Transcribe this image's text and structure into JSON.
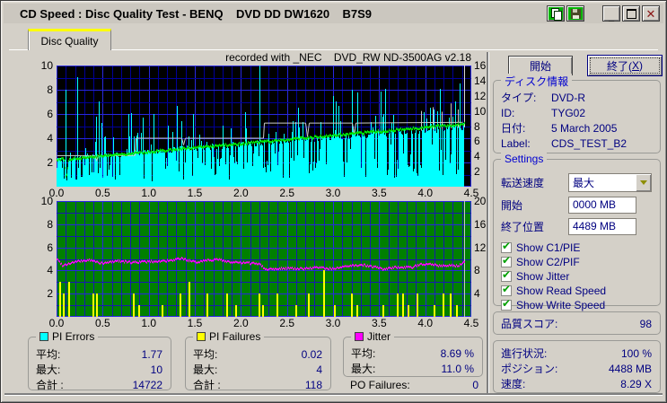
{
  "window": {
    "title": "CD Speed : Disc Quality Test - BENQ    DVD DD DW1620    B7S9",
    "glyphs": {
      "minimize": "_",
      "close": "✕"
    },
    "titlebar_icon_names": [
      "copy-icon",
      "save-icon",
      "minimize-icon",
      "maximize-icon",
      "close-icon"
    ]
  },
  "tabs": [
    {
      "label": "Disc Quality",
      "selected": true
    }
  ],
  "recorded_with": "recorded with _NEC    DVD_RW ND-3500AG v2.18",
  "buttons": {
    "start": "開始",
    "exit_pre": "終了(",
    "exit_key": "X",
    "exit_post": ")"
  },
  "disc_info": {
    "caption": "ディスク情報",
    "fields": [
      {
        "label": "タイプ:",
        "value": "DVD-R"
      },
      {
        "label": "ID:",
        "value": "TYG02"
      },
      {
        "label": "日付:",
        "value": "5 March 2005"
      },
      {
        "label": "Label:",
        "value": "CDS_TEST_B2"
      }
    ]
  },
  "settings": {
    "caption": "Settings",
    "transfer_rate": {
      "label": "転送速度",
      "value": "最大"
    },
    "start": {
      "label": "開始",
      "value": "0000 MB"
    },
    "end": {
      "label": "終了位置",
      "value": "4489 MB"
    },
    "checkboxes": [
      {
        "label": "Show C1/PIE",
        "checked": true
      },
      {
        "label": "Show C2/PIF",
        "checked": true
      },
      {
        "label": "Show Jitter",
        "checked": true
      },
      {
        "label": "Show Read Speed",
        "checked": true
      },
      {
        "label": "Show Write Speed",
        "checked": true
      }
    ],
    "check_glyph": "✔"
  },
  "quality_score": {
    "label": "品質スコア:",
    "value": "98"
  },
  "progress": {
    "fields": [
      {
        "label": "進行状況:",
        "value": "100 %"
      },
      {
        "label": "ポジション:",
        "value": "4488 MB"
      },
      {
        "label": "速度:",
        "value": "8.29 X"
      }
    ]
  },
  "stats": {
    "pi_errors": {
      "caption": "PI Errors",
      "swatch": "#00FFFF",
      "rows": [
        {
          "label": "平均:",
          "value": "1.77"
        },
        {
          "label": "最大:",
          "value": "10"
        },
        {
          "label": "合計 :",
          "value": "14722"
        }
      ]
    },
    "pi_failures": {
      "caption": "PI Failures",
      "swatch": "#FFFF00",
      "rows": [
        {
          "label": "平均:",
          "value": "0.02"
        },
        {
          "label": "最大:",
          "value": "4"
        },
        {
          "label": "合計 :",
          "value": "118"
        }
      ]
    },
    "jitter": {
      "caption": "Jitter",
      "swatch": "#FF00FF",
      "rows": [
        {
          "label": "平均:",
          "value": "8.69 %"
        },
        {
          "label": "最大:",
          "value": "11.0 %"
        }
      ]
    },
    "po_failures": {
      "label": "PO Failures:",
      "value": "0"
    }
  },
  "chart_data": [
    {
      "type": "area",
      "name": "PI Errors with Read/Write Speed overlay",
      "bg": "#000000",
      "grid_minor": "#000098",
      "grid_major": "#2828e0",
      "xlim": [
        0,
        4.5
      ],
      "x_unit": "GB",
      "data_end_gb": 4.42,
      "x_ticks": [
        "0.0",
        "0.5",
        "1.0",
        "1.5",
        "2.0",
        "2.5",
        "3.0",
        "3.5",
        "4.0",
        "4.5"
      ],
      "left_axis": {
        "range": [
          0,
          10
        ],
        "ticks": [
          "10",
          "8",
          "6",
          "4",
          "2"
        ],
        "series": "PI Errors"
      },
      "right_axis": {
        "range": [
          0,
          16
        ],
        "ticks": [
          "16",
          "14",
          "12",
          "10",
          "8",
          "6",
          "4",
          "2"
        ],
        "series": "Speed (X)"
      },
      "series": [
        {
          "name": "PI Errors",
          "color": "#00ffff",
          "style": "spikes",
          "axis": "left",
          "average": 1.77,
          "maximum": 10,
          "total": 14722,
          "seed": 1337,
          "envelope": [
            [
              0,
              2.3
            ],
            [
              4.42,
              4.9
            ]
          ],
          "tall_spikes": [
            [
              0.1,
              8
            ],
            [
              0.22,
              9
            ],
            [
              0.46,
              7
            ],
            [
              0.78,
              6
            ],
            [
              1.05,
              6
            ],
            [
              1.48,
              6
            ],
            [
              2.2,
              10
            ],
            [
              2.62,
              6.5
            ],
            [
              3.2,
              8
            ],
            [
              3.55,
              6
            ],
            [
              4.05,
              6.5
            ],
            [
              4.32,
              7
            ]
          ]
        },
        {
          "name": "Write Speed",
          "color": "#cccccc",
          "style": "step-line",
          "axis": "right",
          "points": [
            [
              0,
              4.1
            ],
            [
              0.42,
              4.1
            ],
            [
              0.43,
              3.4
            ],
            [
              0.45,
              4.1
            ],
            [
              0.85,
              4.1
            ],
            [
              0.86,
              6.4
            ],
            [
              1.35,
              6.4
            ],
            [
              1.37,
              5.5
            ],
            [
              1.39,
              6.4
            ],
            [
              2.24,
              6.4
            ],
            [
              2.25,
              8.4
            ],
            [
              2.7,
              8.4
            ],
            [
              2.72,
              6.6
            ],
            [
              2.74,
              8.4
            ],
            [
              3.2,
              8.4
            ],
            [
              3.22,
              6.9
            ],
            [
              3.24,
              8.4
            ],
            [
              4.4,
              8.5
            ]
          ],
          "spikes": [
            [
              3.95,
              10.0
            ],
            [
              4.08,
              10.5
            ],
            [
              4.18,
              9.9
            ],
            [
              4.28,
              11.0
            ],
            [
              4.35,
              10.2
            ]
          ],
          "end_marker_gb": 4.42
        },
        {
          "name": "Read Speed",
          "color": "#00e400",
          "style": "noisy-line",
          "axis": "right",
          "points": [
            [
              0,
              3.6
            ],
            [
              0.08,
              3.68
            ],
            [
              0.1,
              0.9
            ],
            [
              0.13,
              3.7
            ],
            [
              4.42,
              8.3
            ]
          ],
          "noise": 0.32,
          "seed": 77,
          "end_value": 8.29
        }
      ]
    },
    {
      "type": "line+spikes",
      "name": "PI Failures with Jitter overlay",
      "bg": "#008000",
      "grid_minor": "#1818b0",
      "grid_major": "#2828e0",
      "xlim": [
        0,
        4.5
      ],
      "x_unit": "GB",
      "data_end_gb": 4.42,
      "x_ticks": [
        "0.0",
        "0.5",
        "1.0",
        "1.5",
        "2.0",
        "2.5",
        "3.0",
        "3.5",
        "4.0",
        "4.5"
      ],
      "left_axis": {
        "range": [
          0,
          10
        ],
        "ticks": [
          "10",
          "8",
          "6",
          "4",
          "2"
        ],
        "series": "PI Failures"
      },
      "right_axis": {
        "range": [
          0,
          20
        ],
        "ticks": [
          "20",
          "16",
          "12",
          "8",
          "4"
        ],
        "series": "Jitter (%)"
      },
      "series": [
        {
          "name": "PI Failures",
          "color": "#ffff00",
          "style": "spikes",
          "axis": "left",
          "average": 0.02,
          "maximum": 4,
          "total": 118,
          "spikes": [
            [
              0.04,
              3
            ],
            [
              0.08,
              2
            ],
            [
              0.14,
              3
            ],
            [
              0.4,
              2
            ],
            [
              0.44,
              2
            ],
            [
              0.84,
              2
            ],
            [
              0.9,
              1
            ],
            [
              1.15,
              1
            ],
            [
              1.34,
              2
            ],
            [
              1.44,
              3
            ],
            [
              1.64,
              2
            ],
            [
              1.85,
              2
            ],
            [
              1.95,
              1
            ],
            [
              2.2,
              2
            ],
            [
              2.24,
              1
            ],
            [
              2.4,
              2
            ],
            [
              2.6,
              1
            ],
            [
              2.74,
              2
            ],
            [
              2.9,
              4
            ],
            [
              3.02,
              1
            ],
            [
              3.2,
              2
            ],
            [
              3.26,
              1
            ],
            [
              3.55,
              1
            ],
            [
              3.7,
              2
            ],
            [
              3.76,
              2
            ],
            [
              3.82,
              1
            ],
            [
              3.92,
              2
            ],
            [
              4.1,
              1
            ],
            [
              4.2,
              2
            ],
            [
              4.28,
              2
            ],
            [
              4.34,
              1
            ]
          ]
        },
        {
          "name": "Jitter",
          "color": "#ff00ff",
          "style": "noisy-line",
          "axis": "right",
          "average_pct": 8.69,
          "maximum_pct": 11.0,
          "noise": 0.36,
          "seed": 99,
          "points": [
            [
              0,
              10.0
            ],
            [
              0.06,
              8.9
            ],
            [
              0.2,
              9.5
            ],
            [
              0.35,
              9.8
            ],
            [
              0.5,
              9.2
            ],
            [
              0.65,
              9.7
            ],
            [
              0.8,
              9.4
            ],
            [
              0.95,
              9.5
            ],
            [
              1.1,
              9.6
            ],
            [
              1.25,
              9.7
            ],
            [
              1.35,
              10.1
            ],
            [
              1.5,
              9.4
            ],
            [
              1.62,
              9.8
            ],
            [
              1.75,
              9.9
            ],
            [
              1.9,
              9.4
            ],
            [
              2.05,
              9.3
            ],
            [
              2.2,
              9.2
            ],
            [
              2.26,
              8.2
            ],
            [
              2.45,
              8.4
            ],
            [
              2.65,
              8.3
            ],
            [
              2.85,
              8.5
            ],
            [
              3.0,
              8.3
            ],
            [
              3.15,
              8.7
            ],
            [
              3.3,
              9.0
            ],
            [
              3.45,
              8.6
            ],
            [
              3.55,
              8.2
            ],
            [
              3.7,
              8.6
            ],
            [
              3.85,
              8.5
            ],
            [
              3.95,
              9.1
            ],
            [
              4.05,
              9.2
            ],
            [
              4.15,
              8.8
            ],
            [
              4.25,
              8.9
            ],
            [
              4.35,
              8.8
            ],
            [
              4.42,
              9.5
            ]
          ],
          "end_marker_gb": 4.42
        }
      ]
    }
  ]
}
